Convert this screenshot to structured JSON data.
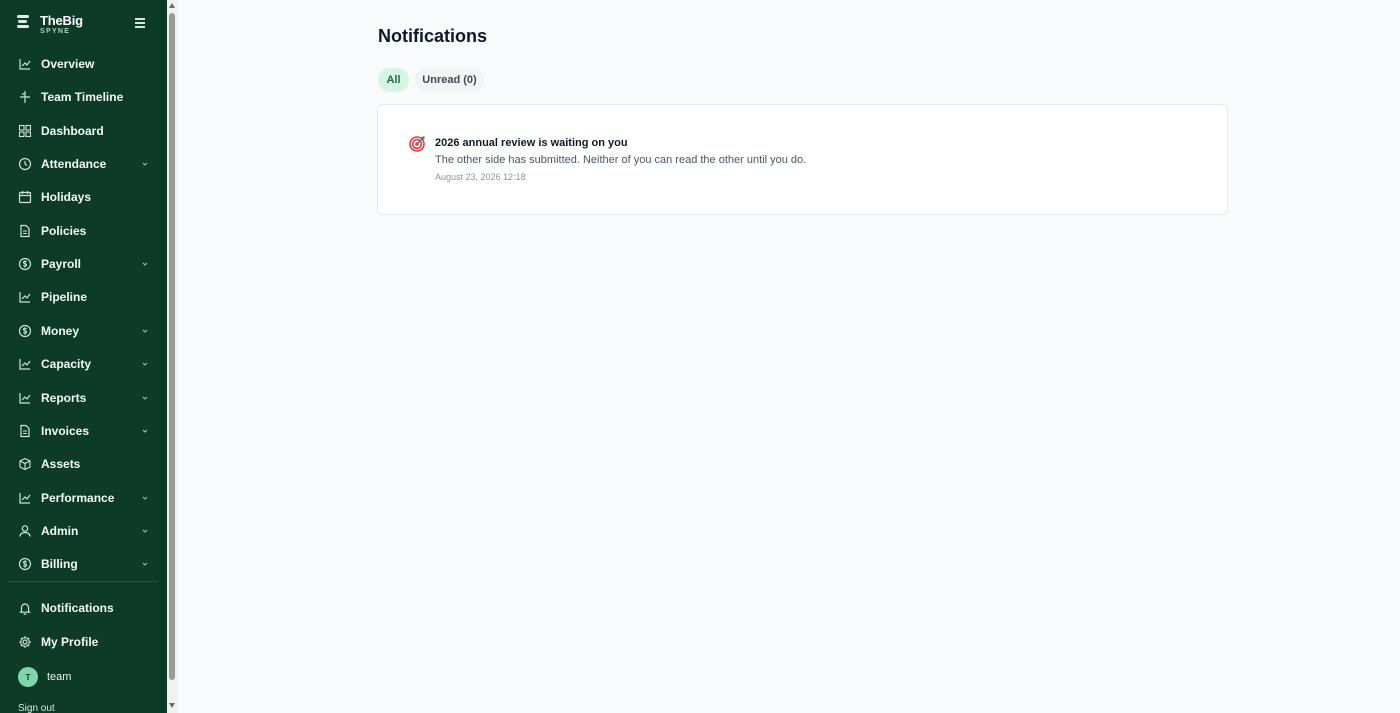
{
  "brand": {
    "name": "TheBig",
    "sub": "SPYNE"
  },
  "sidebar": {
    "items": [
      {
        "label": "Overview",
        "icon": "chart-line-icon",
        "chevron": false
      },
      {
        "label": "Team Timeline",
        "icon": "timeline-icon",
        "chevron": false
      },
      {
        "label": "Dashboard",
        "icon": "grid-icon",
        "chevron": false
      },
      {
        "label": "Attendance",
        "icon": "clock-icon",
        "chevron": true
      },
      {
        "label": "Holidays",
        "icon": "calendar-icon",
        "chevron": false
      },
      {
        "label": "Policies",
        "icon": "document-icon",
        "chevron": false
      },
      {
        "label": "Payroll",
        "icon": "dollar-icon",
        "chevron": true
      },
      {
        "label": "Pipeline",
        "icon": "chart-line-icon",
        "chevron": false
      },
      {
        "label": "Money",
        "icon": "dollar-icon",
        "chevron": true
      },
      {
        "label": "Capacity",
        "icon": "chart-line-icon",
        "chevron": true
      },
      {
        "label": "Reports",
        "icon": "chart-line-icon",
        "chevron": true
      },
      {
        "label": "Invoices",
        "icon": "document-icon",
        "chevron": true
      },
      {
        "label": "Assets",
        "icon": "box-icon",
        "chevron": false
      },
      {
        "label": "Performance",
        "icon": "chart-line-icon",
        "chevron": true
      },
      {
        "label": "Admin",
        "icon": "user-icon",
        "chevron": true
      },
      {
        "label": "Billing",
        "icon": "dollar-icon",
        "chevron": true
      }
    ],
    "bottom_items": [
      {
        "label": "Notifications",
        "icon": "bell-icon"
      },
      {
        "label": "My Profile",
        "icon": "gear-icon"
      }
    ],
    "user": {
      "initial": "T",
      "name": "team"
    },
    "signout": "Sign out"
  },
  "main": {
    "title": "Notifications",
    "tabs": {
      "all": "All",
      "unread": "Unread (0)"
    },
    "notifications": [
      {
        "icon": "target-icon",
        "title": "2026 annual review is waiting on you",
        "body": "The other side has submitted. Neither of you can read the other until you do.",
        "time": "August 23, 2026 12:18"
      }
    ]
  },
  "colors": {
    "sidebar_bg": "#0d3b28",
    "accent": "#1d6b44",
    "accent_bg": "#d6f5e3",
    "page_bg": "#f8fafb"
  }
}
